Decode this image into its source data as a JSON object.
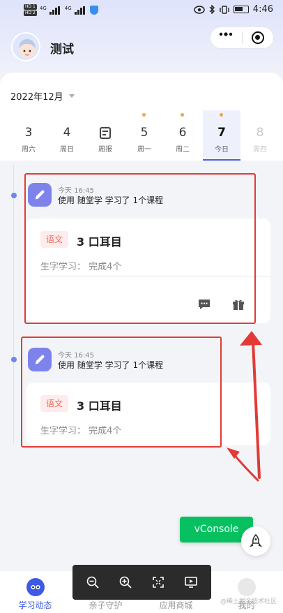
{
  "status_bar": {
    "sim1": "HD 1",
    "sim2": "HD 2",
    "net1": "4G",
    "net2": "4G",
    "time": "4:46"
  },
  "header": {
    "title": "测试"
  },
  "calendar": {
    "month": "2022年12月",
    "days": [
      {
        "num": "3",
        "label": "周六",
        "dot": false
      },
      {
        "num": "4",
        "label": "周日",
        "dot": false
      },
      {
        "num": "",
        "label": "周报",
        "dot": false
      },
      {
        "num": "5",
        "label": "周一",
        "dot": true
      },
      {
        "num": "6",
        "label": "周二",
        "dot": true
      },
      {
        "num": "7",
        "label": "今日",
        "dot": true
      },
      {
        "num": "8",
        "label": "周四",
        "dot": false
      }
    ]
  },
  "entries": [
    {
      "time": "今天 16:45",
      "desc": "使用 随堂学 学习了 1个课程",
      "subject": "语文",
      "course": "3 口耳目",
      "detail": "生字学习：  完成4个"
    },
    {
      "time": "今天 16:45",
      "desc": "使用 随堂学 学习了 1个课程",
      "subject": "语文",
      "course": "3 口耳目",
      "detail": "生字学习：  完成4个"
    }
  ],
  "vconsole": {
    "label": "vConsole"
  },
  "tabs": [
    {
      "label": "学习动态",
      "active": true
    },
    {
      "label": "亲子守护",
      "active": false
    },
    {
      "label": "应用商城",
      "active": false
    },
    {
      "label": "我的",
      "active": false
    }
  ],
  "watermark": "@稀土掘金技术社区",
  "colors": {
    "accent": "#3c5ae6",
    "dot": "#f0a44a",
    "subject_bg": "#fdeceb",
    "subject_fg": "#ec6c5f",
    "annotation": "#e33a36",
    "vconsole": "#07c160"
  }
}
